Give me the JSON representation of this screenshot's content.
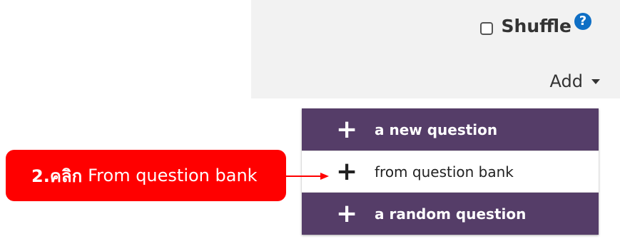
{
  "question_panel": {
    "shuffle_label": "Shuffle",
    "help_glyph": "?",
    "add_label": "Add"
  },
  "add_menu": {
    "items": [
      {
        "label": "a new question",
        "icon": "plus-icon",
        "style": "dark"
      },
      {
        "label": "from question bank",
        "icon": "plus-icon",
        "style": "light"
      },
      {
        "label": "a random question",
        "icon": "plus-icon",
        "style": "dark"
      }
    ]
  },
  "annotation": {
    "step": "2.คลิก",
    "text": "From question bank"
  },
  "colors": {
    "menu_dark": "#553d68",
    "annotation_red": "#ff0000",
    "help_blue": "#0f6fc5"
  }
}
